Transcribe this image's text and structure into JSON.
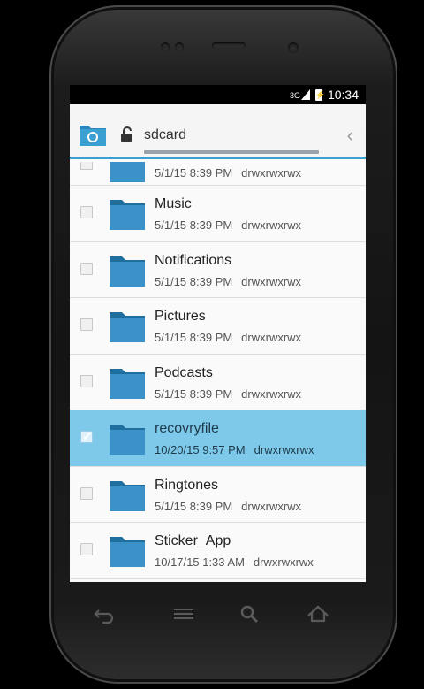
{
  "status_bar": {
    "network": "3G",
    "battery_glyph": "⚡",
    "time": "10:34"
  },
  "header": {
    "path": "sdcard",
    "back_glyph": "‹"
  },
  "partial_row": {
    "date": "5/1/15 8:39 PM",
    "perms": "drwxrwxrwx"
  },
  "files": [
    {
      "name": "Music",
      "date": "5/1/15 8:39 PM",
      "perms": "drwxrwxrwx",
      "checked": false
    },
    {
      "name": "Notifications",
      "date": "5/1/15 8:39 PM",
      "perms": "drwxrwxrwx",
      "checked": false
    },
    {
      "name": "Pictures",
      "date": "5/1/15 8:39 PM",
      "perms": "drwxrwxrwx",
      "checked": false
    },
    {
      "name": "Podcasts",
      "date": "5/1/15 8:39 PM",
      "perms": "drwxrwxrwx",
      "checked": false
    },
    {
      "name": "recovryfile",
      "date": "10/20/15 9:57 PM",
      "perms": "drwxrwxrwx",
      "checked": true
    },
    {
      "name": "Ringtones",
      "date": "5/1/15 8:39 PM",
      "perms": "drwxrwxrwx",
      "checked": false
    },
    {
      "name": "Sticker_App",
      "date": "10/17/15 1:33 AM",
      "perms": "drwxrwxrwx",
      "checked": false
    }
  ],
  "colors": {
    "accent": "#3a9fd1",
    "selected_row": "#7ec9e9",
    "folder": "#2f86bd"
  },
  "icons": {
    "header_folder": "folder-icon",
    "lock": "unlock-icon",
    "nav_back": "back-arrow-icon",
    "nav_menu": "menu-icon",
    "nav_search": "search-icon",
    "nav_home": "home-icon"
  }
}
